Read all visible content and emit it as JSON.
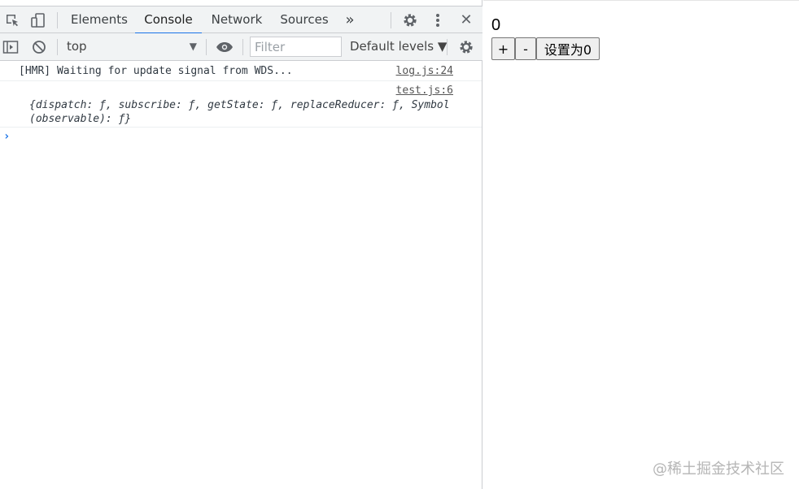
{
  "devtools": {
    "tabs": [
      {
        "label": "Elements"
      },
      {
        "label": "Console"
      },
      {
        "label": "Network"
      },
      {
        "label": "Sources"
      }
    ],
    "more_tabs_glyph": "»",
    "close_glyph": "✕",
    "context_select": "top",
    "filter_placeholder": "Filter",
    "levels_label": "Default levels ▼",
    "icons": [
      "inspect-element-icon",
      "device-toolbar-icon",
      "settings-icon",
      "more-options-icon",
      "close-icon",
      "sidebar-toggle-icon",
      "clear-console-icon",
      "live-expression-eye-icon",
      "console-settings-icon"
    ]
  },
  "console": {
    "messages": [
      {
        "text": "[HMR] Waiting for update signal from WDS...",
        "source": "log.js:24"
      },
      {
        "text": "{dispatch: ƒ, subscribe: ƒ, getState: ƒ, replaceReducer: ƒ, Symbol(observable): ƒ}",
        "source": "test.js:6"
      }
    ],
    "prompt_glyph": "›"
  },
  "app": {
    "counter": "0",
    "buttons": {
      "plus": "+",
      "minus": "-",
      "reset": "设置为0"
    }
  },
  "watermark": "@稀土掘金技术社区",
  "colors": {
    "accent": "#1a73e8",
    "toolbar_bg": "#f1f3f4",
    "border": "#cbcdd1"
  }
}
